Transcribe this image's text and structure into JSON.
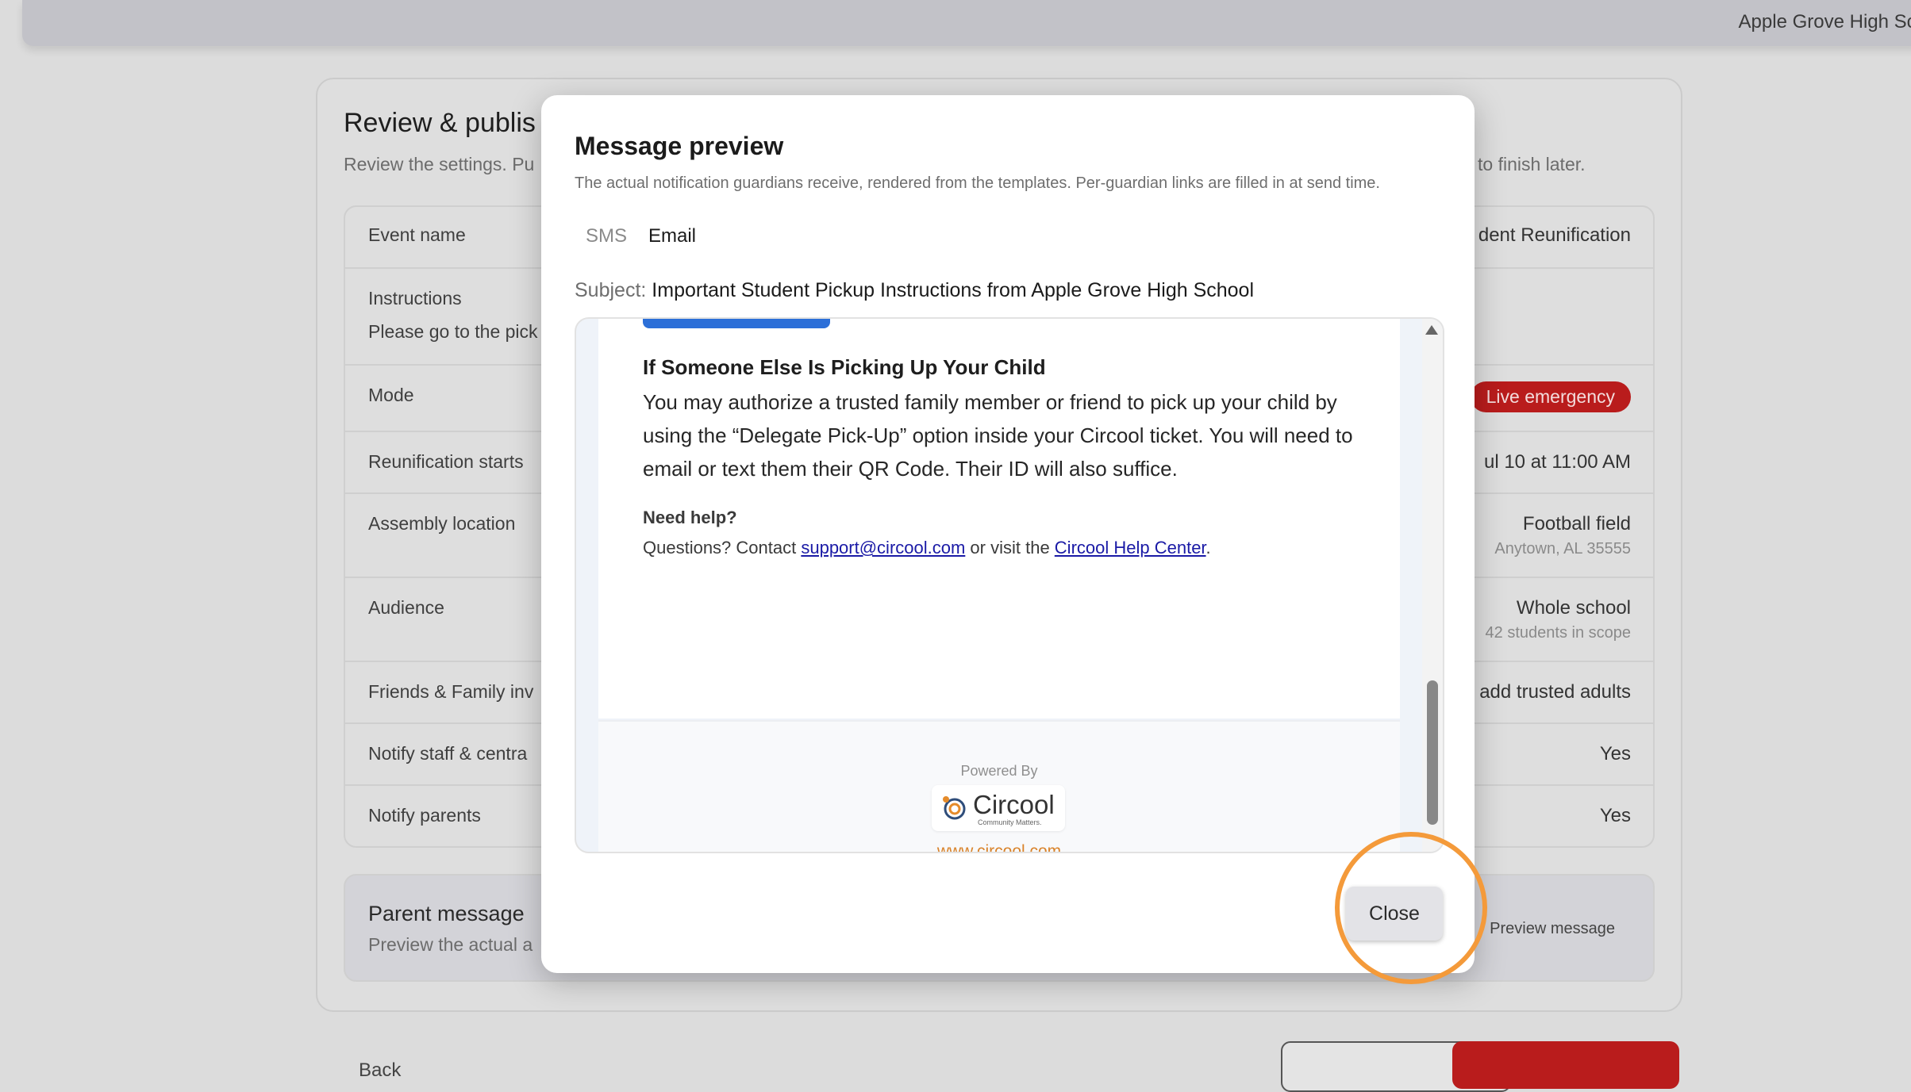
{
  "header": {
    "school": "Apple Grove High Sch"
  },
  "review": {
    "title": "Review & publis",
    "subtitle": "Review the settings. Pu",
    "subtitle_right": "to finish later.",
    "rows": [
      {
        "label": "Event name",
        "value": "dent Reunification"
      },
      {
        "label": "Instructions",
        "sub_label": "Please go to the pick"
      },
      {
        "label": "Mode",
        "badge": "Live emergency"
      },
      {
        "label": "Reunification starts",
        "value": "ul 10 at 11:00 AM"
      },
      {
        "label": "Assembly location",
        "value": "Football field",
        "sub": "Anytown, AL 35555"
      },
      {
        "label": "Audience",
        "value": "Whole school",
        "sub": "42 students in scope"
      },
      {
        "label": "Friends & Family inv",
        "value": "add trusted adults"
      },
      {
        "label": "Notify staff & centra",
        "value": "Yes"
      },
      {
        "label": "Notify parents",
        "value": "Yes"
      }
    ],
    "parent_message": {
      "title": "Parent message",
      "subtitle": "Preview the actual a",
      "preview_button": "Preview message"
    },
    "back_label": "Back"
  },
  "modal": {
    "title": "Message preview",
    "description": "The actual notification guardians receive, rendered from the templates. Per-guardian links are filled in at send time.",
    "tabs": {
      "sms": "SMS",
      "email": "Email"
    },
    "subject_label": "Subject:",
    "subject_value": "Important Student Pickup Instructions from Apple Grove High School",
    "email": {
      "heading": "If Someone Else Is Picking Up Your Child",
      "paragraph": "You may authorize a trusted family member or friend to pick up your child by using the “Delegate Pick-Up” option inside your Circool ticket. You will need to email or text them their QR Code. Their ID will also suffice.",
      "help_heading": "Need help?",
      "help_prefix": "Questions? Contact ",
      "help_email": "support@circool.com",
      "help_middle": " or visit the ",
      "help_center": "Circool Help Center",
      "help_suffix": ".",
      "powered_by": "Powered By",
      "logo_word": "Circool",
      "logo_tagline": "Community Matters.",
      "website": "www.circool.com"
    },
    "close_label": "Close"
  },
  "colors": {
    "emergency": "#b91c1c",
    "link": "#1a1aa6",
    "accent_orange": "#f49a3a",
    "cta_blue": "#2c6fd8"
  }
}
